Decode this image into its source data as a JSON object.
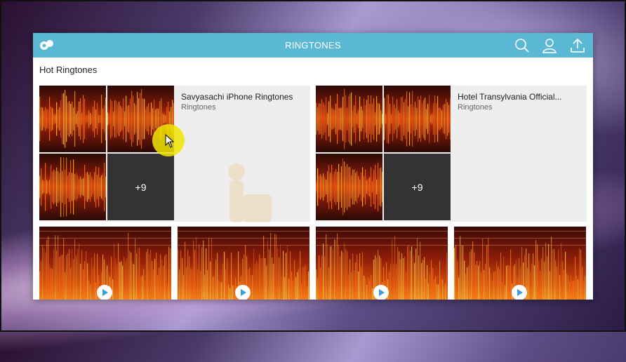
{
  "header": {
    "title": "RINGTONES",
    "icons": [
      "logo-icon",
      "search-icon",
      "user-icon",
      "upload-icon"
    ]
  },
  "section_title": "Hot Ringtones",
  "albums": [
    {
      "name": "Savyasachi iPhone Ringtones",
      "category": "Ringtones",
      "more_count": "+9"
    },
    {
      "name": "Hotel Transylvania Official...",
      "category": "Ringtones",
      "more_count": "+9"
    }
  ],
  "tracks_visible": 4,
  "colors": {
    "header_bg": "#5bb8d5",
    "album_bg": "#eeeeee",
    "more_tile_bg": "#333333",
    "play_accent": "#3a9fd8"
  }
}
